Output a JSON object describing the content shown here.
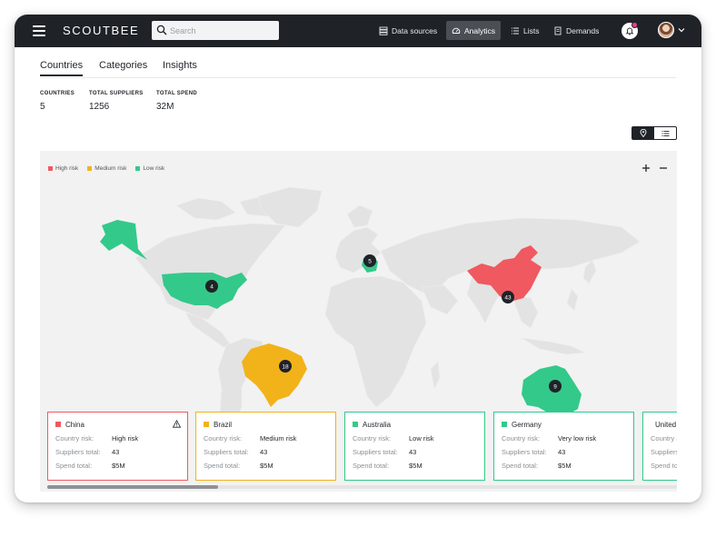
{
  "app": {
    "logo": "SCOUTBEE"
  },
  "header": {
    "search_placeholder": "Search",
    "nav": [
      {
        "label": "Data sources",
        "icon": "database-icon"
      },
      {
        "label": "Analytics",
        "icon": "gauge-icon",
        "active": true
      },
      {
        "label": "Lists",
        "icon": "list-icon"
      },
      {
        "label": "Demands",
        "icon": "document-icon"
      }
    ],
    "notification_count": 1
  },
  "tabs": [
    {
      "label": "Countries",
      "active": true
    },
    {
      "label": "Categories",
      "active": false
    },
    {
      "label": "Insights",
      "active": false
    }
  ],
  "stats": [
    {
      "label": "COUNTRIES",
      "value": "5"
    },
    {
      "label": "TOTAL SUPPLIERS",
      "value": "1256"
    },
    {
      "label": "TOTAL SPEND",
      "value": "32M"
    }
  ],
  "view_toggle": {
    "active": "map"
  },
  "map": {
    "legend": [
      {
        "label": "High risk",
        "color": "#f0595f"
      },
      {
        "label": "Medium risk",
        "color": "#f2b21a"
      },
      {
        "label": "Low risk",
        "color": "#33c98a"
      }
    ],
    "markers": [
      {
        "region": "usa",
        "count": "4"
      },
      {
        "region": "europe",
        "count": "5"
      },
      {
        "region": "china",
        "count": "43"
      },
      {
        "region": "brazil",
        "count": "18"
      },
      {
        "region": "australia",
        "count": "9"
      }
    ],
    "colors": {
      "base": "#e4e4e4",
      "ocean": "#f2f2f2",
      "high": "#f0595f",
      "medium": "#f2b21a",
      "low": "#33c98a"
    }
  },
  "labels": {
    "risk": "Country risk:",
    "suppliers": "Suppliers total:",
    "spend": "Spend total:"
  },
  "cards": [
    {
      "country": "China",
      "risk": "High risk",
      "suppliers": "43",
      "spend": "$5M",
      "color": "#f0595f",
      "warning": true
    },
    {
      "country": "Brazil",
      "risk": "Medium risk",
      "suppliers": "43",
      "spend": "$5M",
      "color": "#f2b21a",
      "warning": false
    },
    {
      "country": "Australia",
      "risk": "Low risk",
      "suppliers": "43",
      "spend": "$5M",
      "color": "#33c98a",
      "warning": false
    },
    {
      "country": "Germany",
      "risk": "Very low risk",
      "suppliers": "43",
      "spend": "$5M",
      "color": "#33c98a",
      "warning": false
    },
    {
      "country": "United",
      "risk": "",
      "suppliers": "",
      "spend": "",
      "color": "#33c98a",
      "warning": false
    }
  ]
}
